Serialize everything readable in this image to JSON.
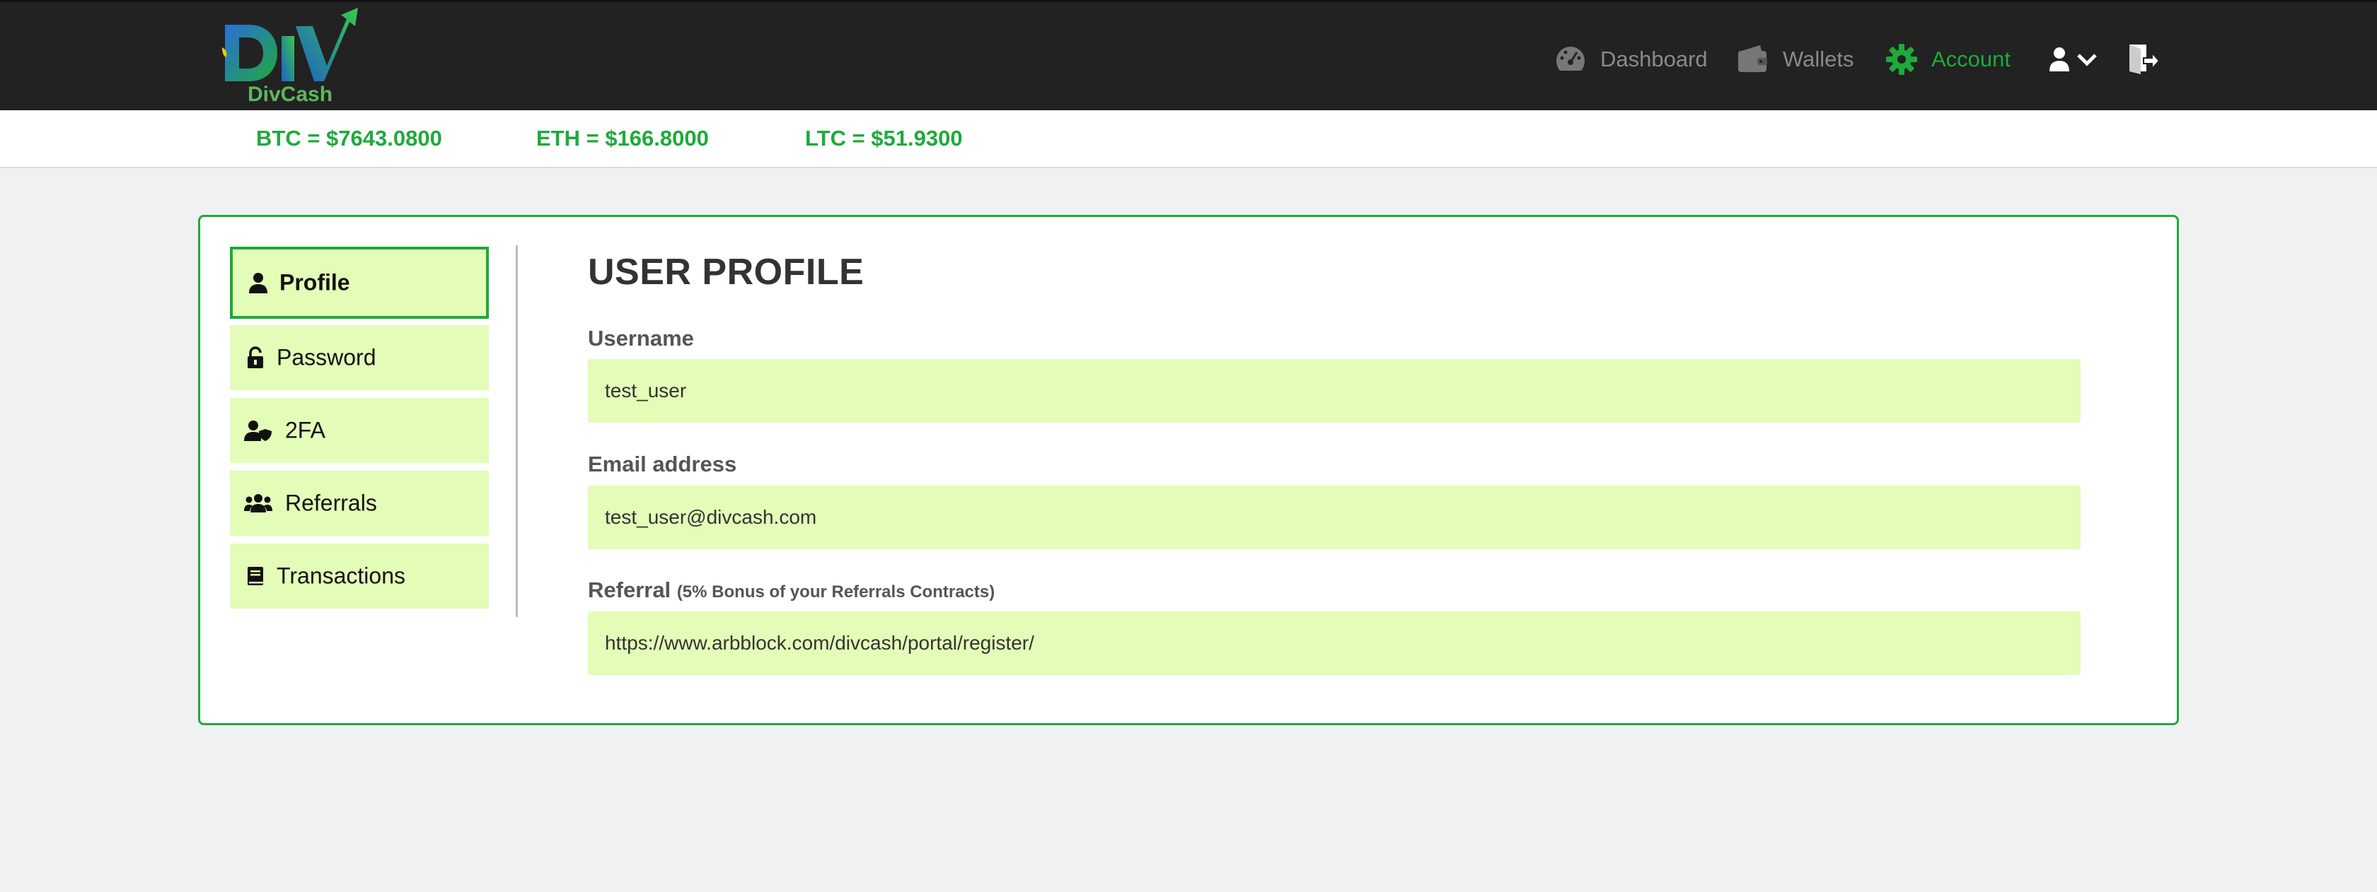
{
  "brand": {
    "name": "DivCash"
  },
  "nav": {
    "items": [
      {
        "label": "Dashboard",
        "icon": "dashboard-gauge-icon"
      },
      {
        "label": "Wallets",
        "icon": "wallet-icon"
      },
      {
        "label": "Account",
        "icon": "gear-icon",
        "active": true
      }
    ],
    "user_icon": "user-icon",
    "logout_icon": "logout-icon"
  },
  "ticker": {
    "btc": "BTC = $7643.0800",
    "eth": "ETH = $166.8000",
    "ltc": "LTC = $51.9300"
  },
  "sidebar": {
    "items": [
      {
        "label": "Profile",
        "icon": "user-icon",
        "active": true
      },
      {
        "label": "Password",
        "icon": "unlock-icon"
      },
      {
        "label": "2FA",
        "icon": "user-shield-icon"
      },
      {
        "label": "Referrals",
        "icon": "users-icon"
      },
      {
        "label": "Transactions",
        "icon": "book-icon"
      }
    ]
  },
  "profile": {
    "title": "USER PROFILE",
    "username_label": "Username",
    "username_value": "test_user",
    "email_label": "Email address",
    "email_value": "test_user@divcash.com",
    "referral_label": "Referral",
    "referral_note": "(5% Bonus of your Referrals Contracts)",
    "referral_value": "https://www.arbblock.com/divcash/portal/register/"
  },
  "colors": {
    "accent": "#1faa3b",
    "field_bg": "#e3fcb7",
    "nav_bg": "#222222"
  }
}
